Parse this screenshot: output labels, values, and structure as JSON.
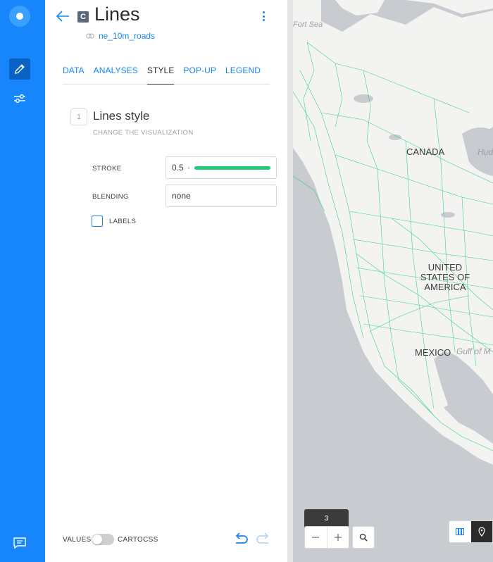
{
  "layer": {
    "badge": "C",
    "title": "Lines",
    "source": "ne_10m_roads"
  },
  "tabs": [
    {
      "label": "DATA"
    },
    {
      "label": "ANALYSES"
    },
    {
      "label": "STYLE"
    },
    {
      "label": "POP-UP"
    },
    {
      "label": "LEGEND"
    }
  ],
  "active_tab": "STYLE",
  "style_section": {
    "step": "1",
    "title": "Lines style",
    "subtitle": "CHANGE THE VISUALIZATION",
    "stroke": {
      "label": "STROKE",
      "value": "0.5",
      "color": "#1fcb77"
    },
    "blending": {
      "label": "BLENDING",
      "value": "none"
    },
    "labels": {
      "label": "LABELS",
      "checked": false
    }
  },
  "footer": {
    "values_label": "VALUES",
    "cartocss_label": "CARTOCSS",
    "toggle_on": false
  },
  "map": {
    "labels": {
      "sea": "Fort Sea",
      "canada": "CANADA",
      "hudson": "Hud",
      "usa": "UNITED STATES OF AMERICA",
      "mexico": "MEXICO",
      "gulf": "Gulf of M"
    },
    "zoom": "3",
    "road_color": "#1fcb77"
  },
  "colors": {
    "brand": "#1785fb",
    "active_tab": "#2b2b2b"
  }
}
